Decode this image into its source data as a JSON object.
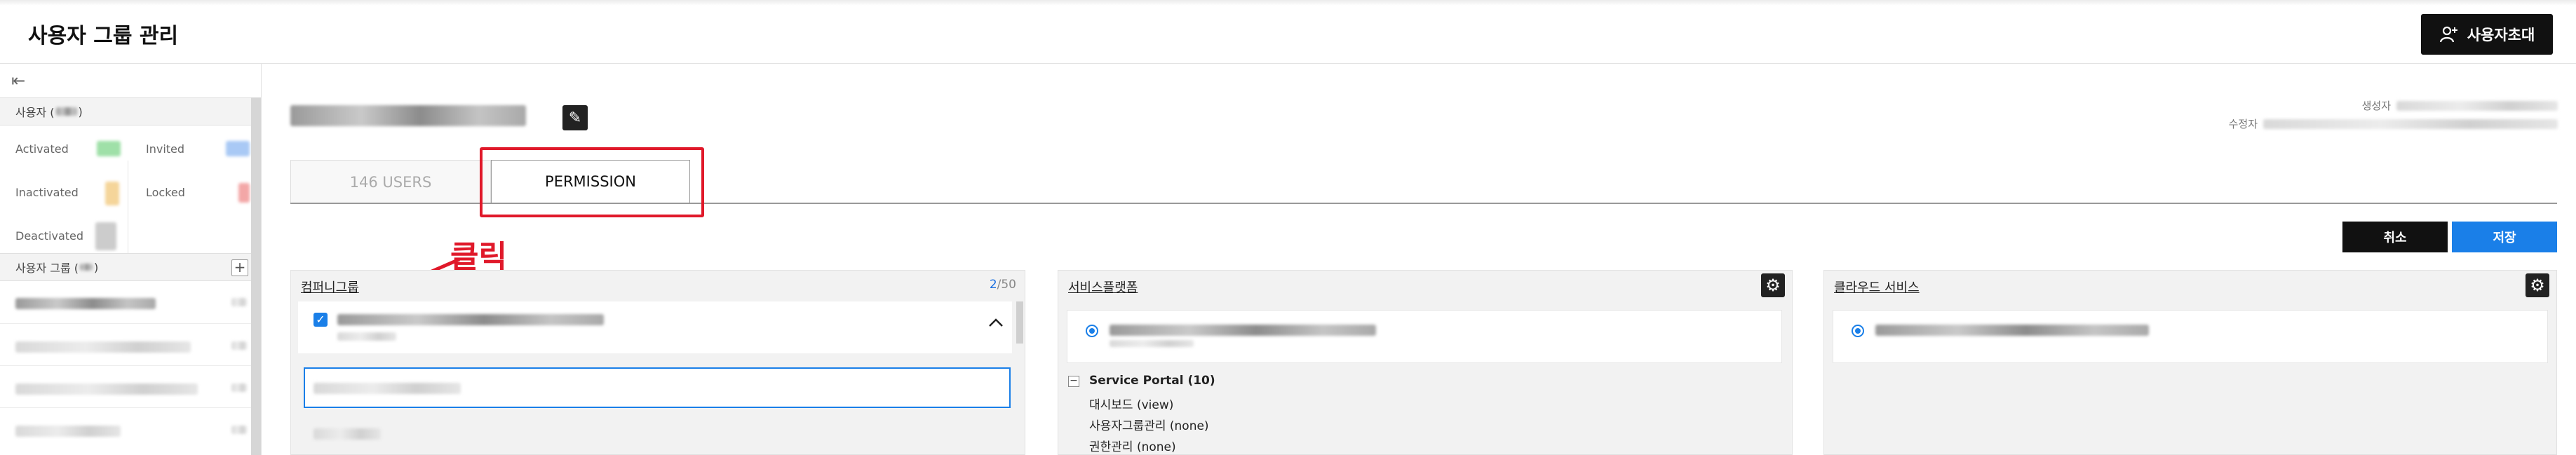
{
  "header": {
    "title": "사용자 그룹 관리",
    "invite_button": "사용자초대"
  },
  "sidebar": {
    "users_section": "사용자 (",
    "users_section_suffix": ")",
    "status": {
      "activated": "Activated",
      "invited": "Invited",
      "inactivated": "Inactivated",
      "locked": "Locked",
      "deactivated": "Deactivated"
    },
    "status_colors": {
      "activated": "#9fe0a8",
      "invited": "#a9c9f5",
      "inactivated": "#f5d59a",
      "locked": "#f3a7a7",
      "deactivated": "#cccccc"
    },
    "groups_section": "사용자 그룹 (",
    "groups_section_suffix": ")",
    "add_icon": "plus-icon"
  },
  "main": {
    "meta": {
      "creator_label": "생성자",
      "modifier_label": "수정자"
    },
    "tabs": [
      {
        "label": "146 USERS"
      },
      {
        "label": "PERMISSION"
      }
    ],
    "actions": {
      "cancel": "취소",
      "save": "저장"
    },
    "annotation": "클릭",
    "panels": {
      "company": {
        "title": "컴퍼니그룹",
        "count_selected": "2",
        "count_total": "/50"
      },
      "service_platform": {
        "title": "서비스플랫폼",
        "tree_root": "Service Portal (10)",
        "tree_items": [
          "대시보드 (view)",
          "사용자그룹관리 (none)",
          "권한관리 (none)"
        ]
      },
      "cloud": {
        "title": "클라우드 서비스"
      }
    }
  }
}
